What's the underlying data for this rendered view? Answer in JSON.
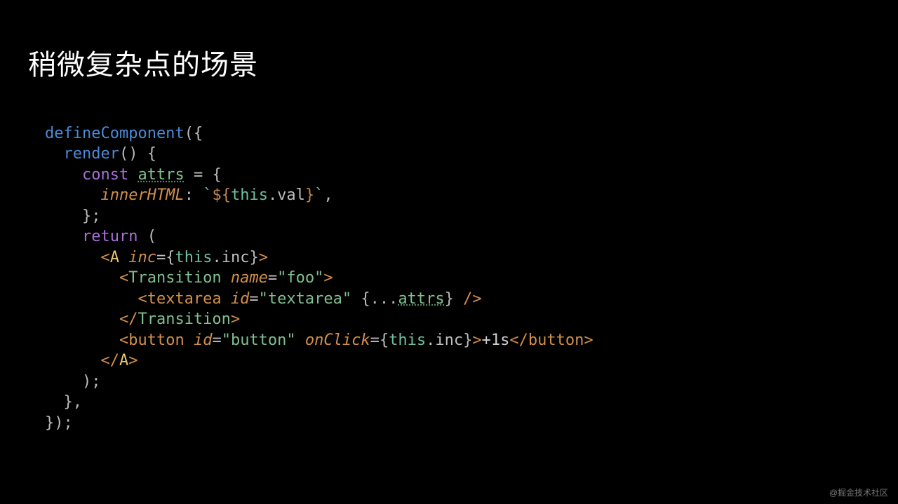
{
  "title": "稍微复杂点的场景",
  "watermark": "@掘金技术社区",
  "code": {
    "l1_fn": "defineComponent",
    "l1_open": "({",
    "l2_render": "render",
    "l2_paren": "() {",
    "l3_const": "const",
    "l3_attrs": "attrs",
    "l3_eq": " = {",
    "l4_key": "innerHTML",
    "l4_colon": ": ",
    "l4_tick1": "`",
    "l4_dopen": "${",
    "l4_this": "this",
    "l4_val": ".val",
    "l4_dclose": "}",
    "l4_tick2": "`",
    "l4_comma": ",",
    "l5_close": "};",
    "l6_return": "return",
    "l6_paren": " (",
    "l7_lt": "<",
    "l7_A": "A",
    "l7_sp": " ",
    "l7_inc": "inc",
    "l7_eq": "=",
    "l7_bo": "{",
    "l7_this": "this",
    "l7_incv": ".inc",
    "l7_bc": "}",
    "l7_gt": ">",
    "l8_lt": "<",
    "l8_T": "Transition",
    "l8_sp": " ",
    "l8_name": "name",
    "l8_eq": "=",
    "l8_val": "\"foo\"",
    "l8_gt": ">",
    "l9_lt": "<",
    "l9_ta": "textarea",
    "l9_sp1": " ",
    "l9_id": "id",
    "l9_eq": "=",
    "l9_idv": "\"textarea\"",
    "l9_sp2": " ",
    "l9_bo": "{",
    "l9_spread": "...",
    "l9_attrs": "attrs",
    "l9_bc": "}",
    "l9_sp3": " ",
    "l9_slash": "/",
    "l9_gt": ">",
    "l10_lt": "<",
    "l10_sl": "/",
    "l10_T": "Transition",
    "l10_gt": ">",
    "l11_lt": "<",
    "l11_btn": "button",
    "l11_sp1": " ",
    "l11_id": "id",
    "l11_eq1": "=",
    "l11_idv": "\"button\"",
    "l11_sp2": " ",
    "l11_oc": "onClick",
    "l11_eq2": "=",
    "l11_bo": "{",
    "l11_this": "this",
    "l11_inc": ".inc",
    "l11_bc": "}",
    "l11_gt": ">",
    "l11_txt": "+1s",
    "l11_lt2": "<",
    "l11_sl": "/",
    "l11_btn2": "button",
    "l11_gt2": ">",
    "l12_lt": "<",
    "l12_sl": "/",
    "l12_A": "A",
    "l12_gt": ">",
    "l13": ");",
    "l14": "},",
    "l15": "});"
  }
}
